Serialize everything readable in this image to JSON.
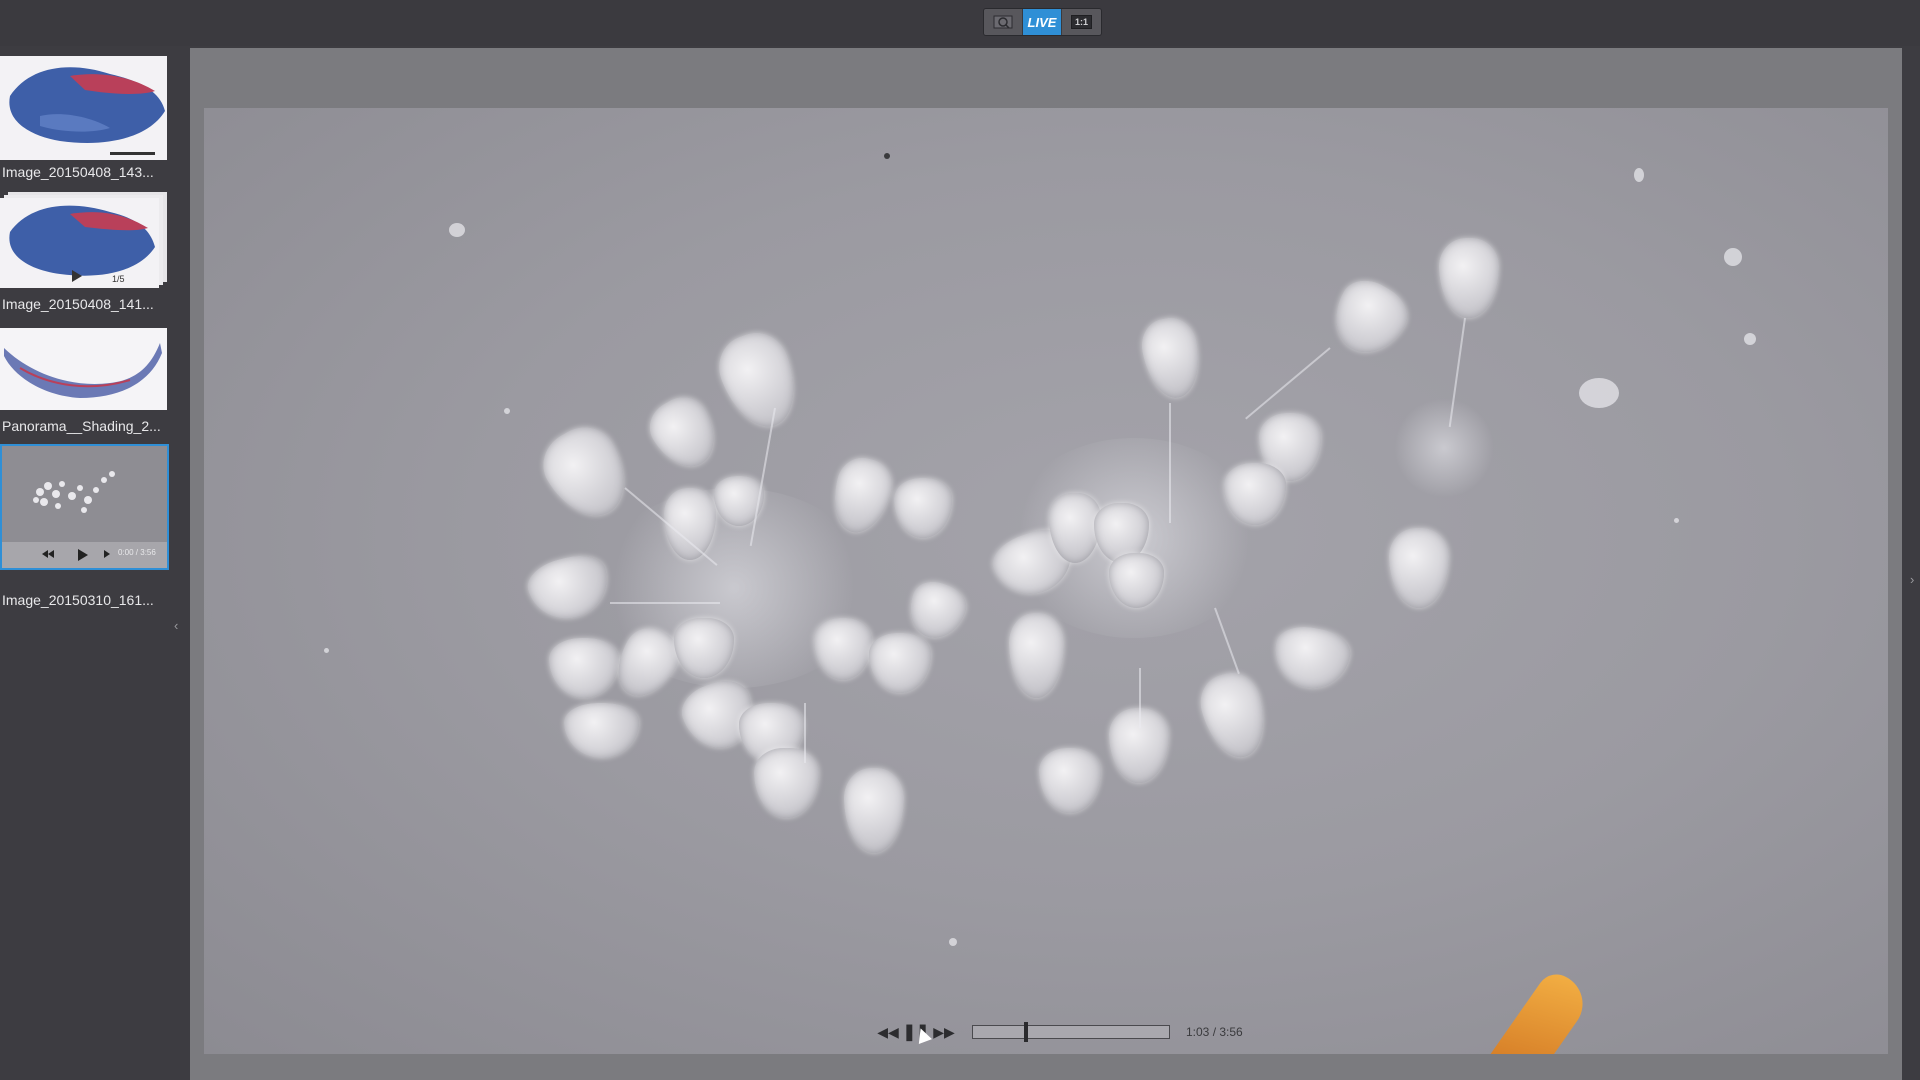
{
  "toolbar": {
    "buttons": [
      {
        "label": "",
        "icon": "magnifier-icon"
      },
      {
        "label": "LIVE"
      },
      {
        "label": "1:1"
      }
    ]
  },
  "gallery": {
    "items": [
      {
        "label": "Image_20150408_143..."
      },
      {
        "label": "Image_20150408_141..."
      },
      {
        "label": "Panorama__Shading_2..."
      },
      {
        "label": "Image_20150310_161..."
      }
    ],
    "item2_counter": "1/5",
    "item4_time": "0:00 / 3:56"
  },
  "player": {
    "time": "1:03 / 3:56",
    "progress": 0.267
  },
  "colors": {
    "accent": "#2f8fd6",
    "background": "#3d3c41"
  }
}
